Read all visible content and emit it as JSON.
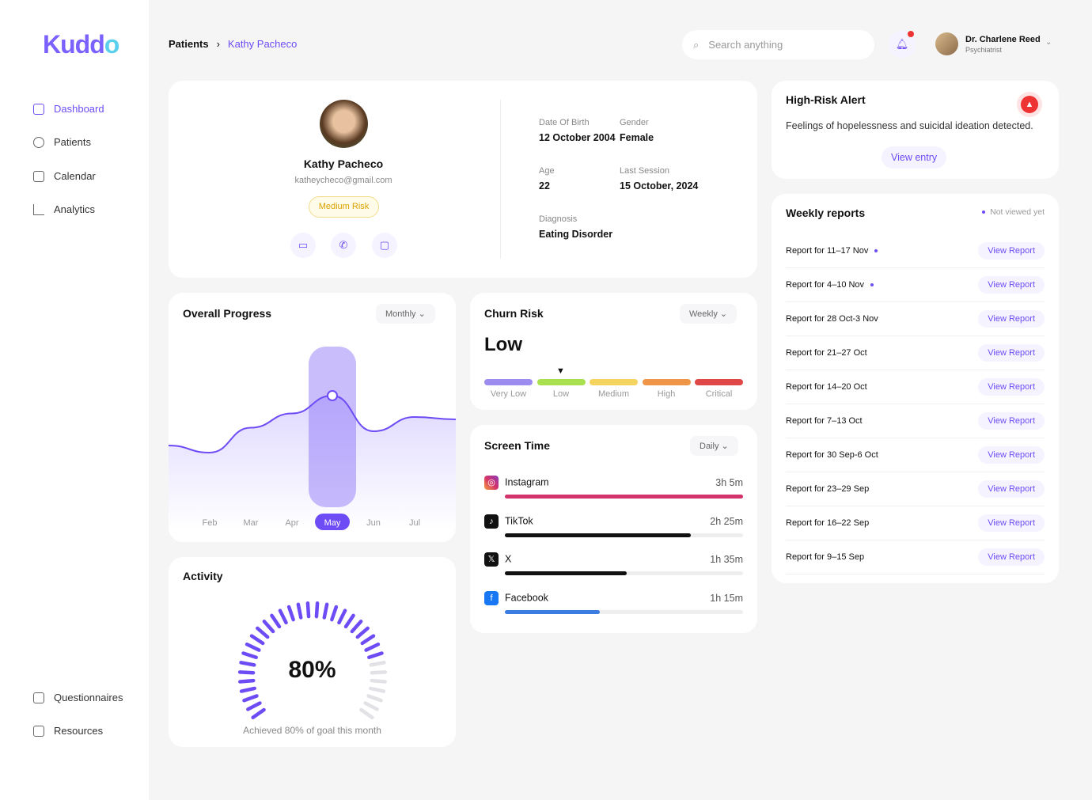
{
  "brand": {
    "logo": "Kuddo",
    "accent": "#6e4cf5"
  },
  "sidebar": {
    "items": [
      {
        "label": "Dashboard",
        "icon": "grid-icon",
        "active": true
      },
      {
        "label": "Patients",
        "icon": "users-icon"
      },
      {
        "label": "Calendar",
        "icon": "calendar-icon"
      },
      {
        "label": "Analytics",
        "icon": "bar-chart-icon"
      }
    ],
    "bottom": [
      {
        "label": "Questionnaires",
        "icon": "clipboard-icon"
      },
      {
        "label": "Resources",
        "icon": "book-icon"
      }
    ]
  },
  "header": {
    "breadcrumb": [
      "Patients",
      "Kathy Pacheco"
    ],
    "search_placeholder": "Search anything",
    "user": {
      "name": "Dr. Charlene Reed",
      "role": "Psychiatrist"
    }
  },
  "patient": {
    "name": "Kathy Pacheco",
    "email": "katheycheco@gmail.com",
    "risk": "Medium Risk",
    "dob_label": "Date Of Birth",
    "dob": "12 October 2004",
    "gender_label": "Gender",
    "gender": "Female",
    "age_label": "Age",
    "age": "22",
    "last_label": "Last Session",
    "last": "15 October, 2024",
    "diag_label": "Diagnosis",
    "diag": "Eating Disorder"
  },
  "progress": {
    "title": "Overall Progress",
    "period": "Monthly",
    "chart_data": {
      "type": "area",
      "categories": [
        "Feb",
        "Mar",
        "Apr",
        "May",
        "Jun",
        "Jul"
      ],
      "values": [
        20,
        55,
        75,
        100,
        50,
        70
      ],
      "highlight": "May"
    }
  },
  "activity": {
    "title": "Activity",
    "percent": 80,
    "value_text": "80%",
    "caption": "Achieved 80% of goal this month"
  },
  "churn": {
    "title": "Churn Risk",
    "period": "Weekly",
    "level": "Low",
    "levels": [
      {
        "label": "Very Low",
        "color": "#9d8cf0"
      },
      {
        "label": "Low",
        "color": "#a8e04f"
      },
      {
        "label": "Medium",
        "color": "#f4d35e"
      },
      {
        "label": "High",
        "color": "#ef9548"
      },
      {
        "label": "Critical",
        "color": "#e04848"
      }
    ],
    "selected": 1
  },
  "screen": {
    "title": "Screen Time",
    "period": "Daily",
    "apps": [
      {
        "name": "Instagram",
        "time": "3h 5m",
        "fraction": 1.0,
        "color": "#d4326a"
      },
      {
        "name": "TikTok",
        "time": "2h 25m",
        "fraction": 0.78,
        "color": "#111111"
      },
      {
        "name": "X",
        "time": "1h 35m",
        "fraction": 0.51,
        "color": "#111111"
      },
      {
        "name": "Facebook",
        "time": "1h 15m",
        "fraction": 0.4,
        "color": "#3b7ce0"
      }
    ]
  },
  "alert": {
    "title": "High-Risk Alert",
    "text": "Feelings of hopelessness and suicidal ideation detected.",
    "button": "View entry"
  },
  "reports": {
    "title": "Weekly reports",
    "legend": "Not viewed yet",
    "button": "View Report",
    "items": [
      {
        "label": "Report for 11–17 Nov",
        "new": true
      },
      {
        "label": "Report for 4–10 Nov",
        "new": true
      },
      {
        "label": "Report for 28 Oct-3 Nov"
      },
      {
        "label": "Report for 21–27 Oct"
      },
      {
        "label": "Report for 14–20 Oct"
      },
      {
        "label": "Report for 7–13 Oct"
      },
      {
        "label": "Report for 30 Sep-6 Oct"
      },
      {
        "label": "Report for 23–29 Sep"
      },
      {
        "label": "Report for 16–22 Sep"
      },
      {
        "label": "Report for 9–15 Sep"
      }
    ]
  }
}
